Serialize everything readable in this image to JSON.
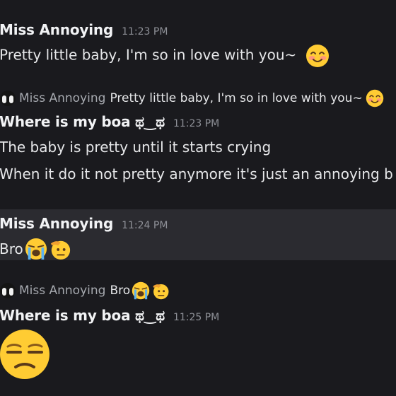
{
  "messages": [
    {
      "author": "Miss Annoying",
      "time": "11:23 PM",
      "text": "Pretty little baby, I'm so in love with you~",
      "emoji": "smiling-face-with-blush"
    },
    {
      "reply_to": {
        "author": "Miss Annoying",
        "text": "Pretty little baby, I'm so in love with you~",
        "emoji": "smiling-face-with-blush"
      },
      "author": "Where is my boa ಥ‿ಥ",
      "time": "11:23 PM",
      "lines": [
        "The baby is pretty until it starts crying",
        "When it do it not pretty anymore it's just an annoying b"
      ]
    },
    {
      "author": "Miss Annoying",
      "time": "11:24 PM",
      "text": "Bro",
      "emojis": [
        "loudly-crying-face",
        "saluting-face"
      ],
      "highlighted": true
    },
    {
      "reply_to": {
        "author": "Miss Annoying",
        "text": "Bro",
        "emojis": [
          "loudly-crying-face",
          "saluting-face"
        ]
      },
      "author": "Where is my boa ಥ‿ಥ",
      "time": "11:25 PM",
      "jumbo_emoji": "unamused-face"
    }
  ],
  "colors": {
    "background": "#1a1a1e",
    "highlight": "#2b2b30",
    "username": "#f2f3f5",
    "timestamp": "#8e9097",
    "text": "#e6e7e9"
  }
}
